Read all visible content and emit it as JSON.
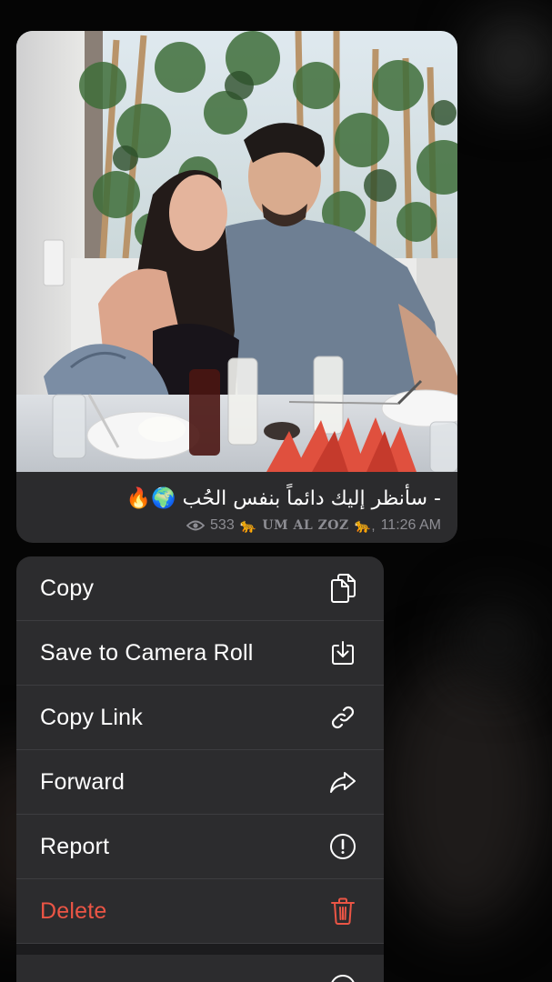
{
  "message": {
    "caption": "- سأنظر إليك دائماً بنفس الحُب 🌍🔥",
    "views": "533",
    "author_prefix": "🐆",
    "author": "UM AL ZOZ",
    "author_suffix": "🐆,",
    "time": "11:26 AM"
  },
  "menu": {
    "items": [
      {
        "label": "Copy",
        "icon": "copy-icon"
      },
      {
        "label": "Save to Camera Roll",
        "icon": "save-download-icon"
      },
      {
        "label": "Copy Link",
        "icon": "link-icon"
      },
      {
        "label": "Forward",
        "icon": "forward-arrow-icon"
      },
      {
        "label": "Report",
        "icon": "report-exclamation-icon"
      },
      {
        "label": "Delete",
        "icon": "trash-icon",
        "color": "#eb5545"
      }
    ]
  },
  "colors": {
    "menu_background": "#2c2c2e",
    "bubble_background": "#2b2b2d",
    "danger": "#eb5545",
    "meta_text": "#8d8d93"
  }
}
